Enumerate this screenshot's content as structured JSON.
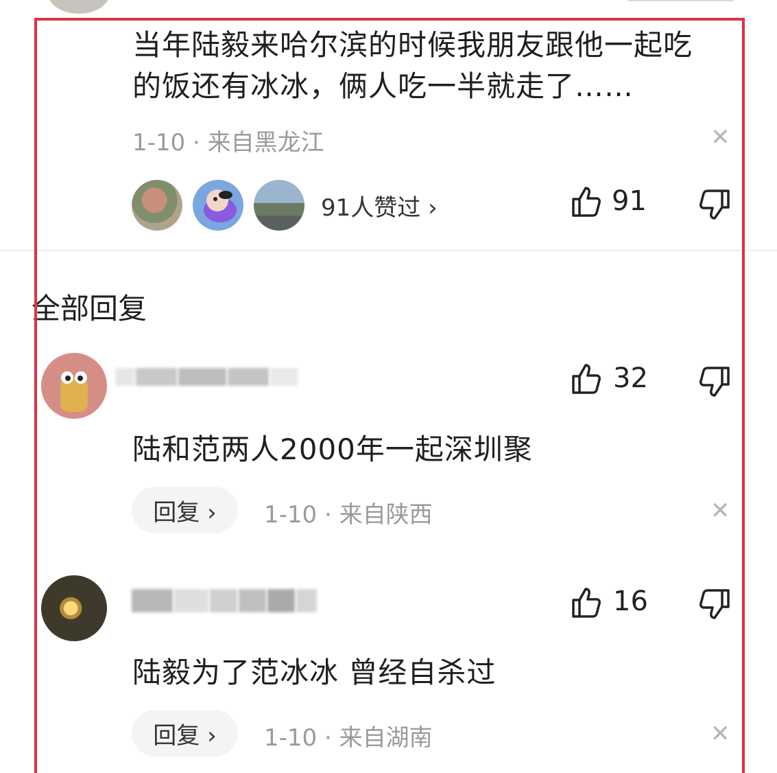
{
  "top_comment": {
    "text": "当年陆毅来哈尔滨的时候我朋友跟他一起吃的饭还有冰冰，俩人吃一半就走了……",
    "date_location": "1-10 · 来自黑龙江",
    "liked_by": "91人赞过 ›",
    "like_count": "91"
  },
  "section_title": "全部回复",
  "replies": [
    {
      "username_masked": "1320112",
      "like_count": "32",
      "text": "陆和范两人2000年一起深圳聚",
      "reply_label": "回复 ›",
      "date_location": "1-10 · 来自陕西"
    },
    {
      "username_masked": "",
      "like_count": "16",
      "text": "陆毅为了范冰冰 曾经自杀过",
      "reply_label": "回复 ›",
      "date_location": "1-10 · 来自湖南"
    }
  ],
  "icons": {
    "like": "thumb-up-icon",
    "dislike": "thumb-down-icon",
    "close": "close-icon"
  },
  "colors": {
    "highlight_frame": "#e0313f",
    "meta_text": "#9a9a9a",
    "pill_bg": "#f4f4f4"
  }
}
